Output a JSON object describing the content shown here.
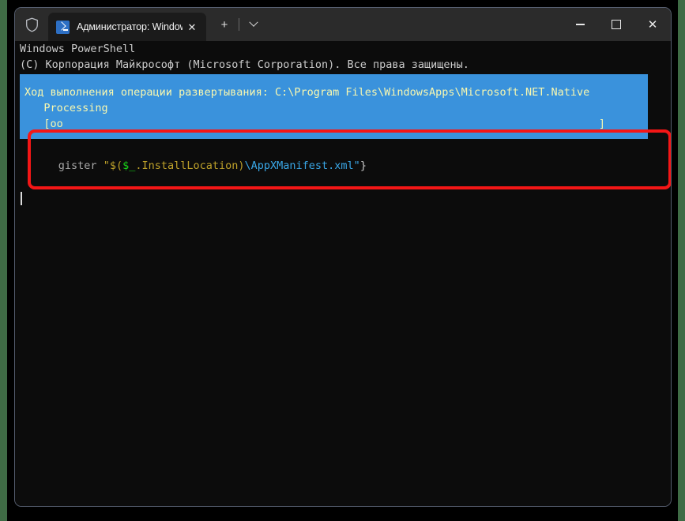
{
  "window": {
    "titlebar": {
      "shield_icon": "shield-icon",
      "tab": {
        "icon": "powershell-icon",
        "title": "Администратор: Windows Po",
        "close_label": "✕"
      },
      "new_tab_label": "+",
      "dropdown_icon": "chevron-down-icon",
      "controls": {
        "minimize_label": "—",
        "maximize_label": "□",
        "close_label": "✕"
      }
    }
  },
  "terminal": {
    "header": [
      "Windows PowerShell",
      "(C) Корпорация Майкрософт (Microsoft Corporation). Все права защищены."
    ],
    "progress": {
      "title": "Ход выполнения операции развертывания: C:\\Program Files\\WindowsApps\\Microsoft.NET.Native",
      "status": "   Processing",
      "bar_open": "   [oo",
      "bar_close": "]",
      "bg_color": "#3a92dc",
      "text_color": "#f8f8b0"
    },
    "command": {
      "segments": [
        {
          "text": "gister ",
          "color": "gray"
        },
        {
          "text": "\"$(",
          "color": "olive"
        },
        {
          "text": "$_",
          "color": "green"
        },
        {
          "text": ".InstallLocation)",
          "color": "olive"
        },
        {
          "text": "\\AppXManifest.xml\"",
          "color": "cyan"
        },
        {
          "text": "}",
          "color": "white"
        }
      ],
      "full_text": "gister \"$($_.InstallLocation)\\AppXManifest.xml\"}"
    },
    "cursor_visible": true
  },
  "annotation": {
    "highlight_color": "#f41616",
    "shape": "rounded-rectangle"
  }
}
